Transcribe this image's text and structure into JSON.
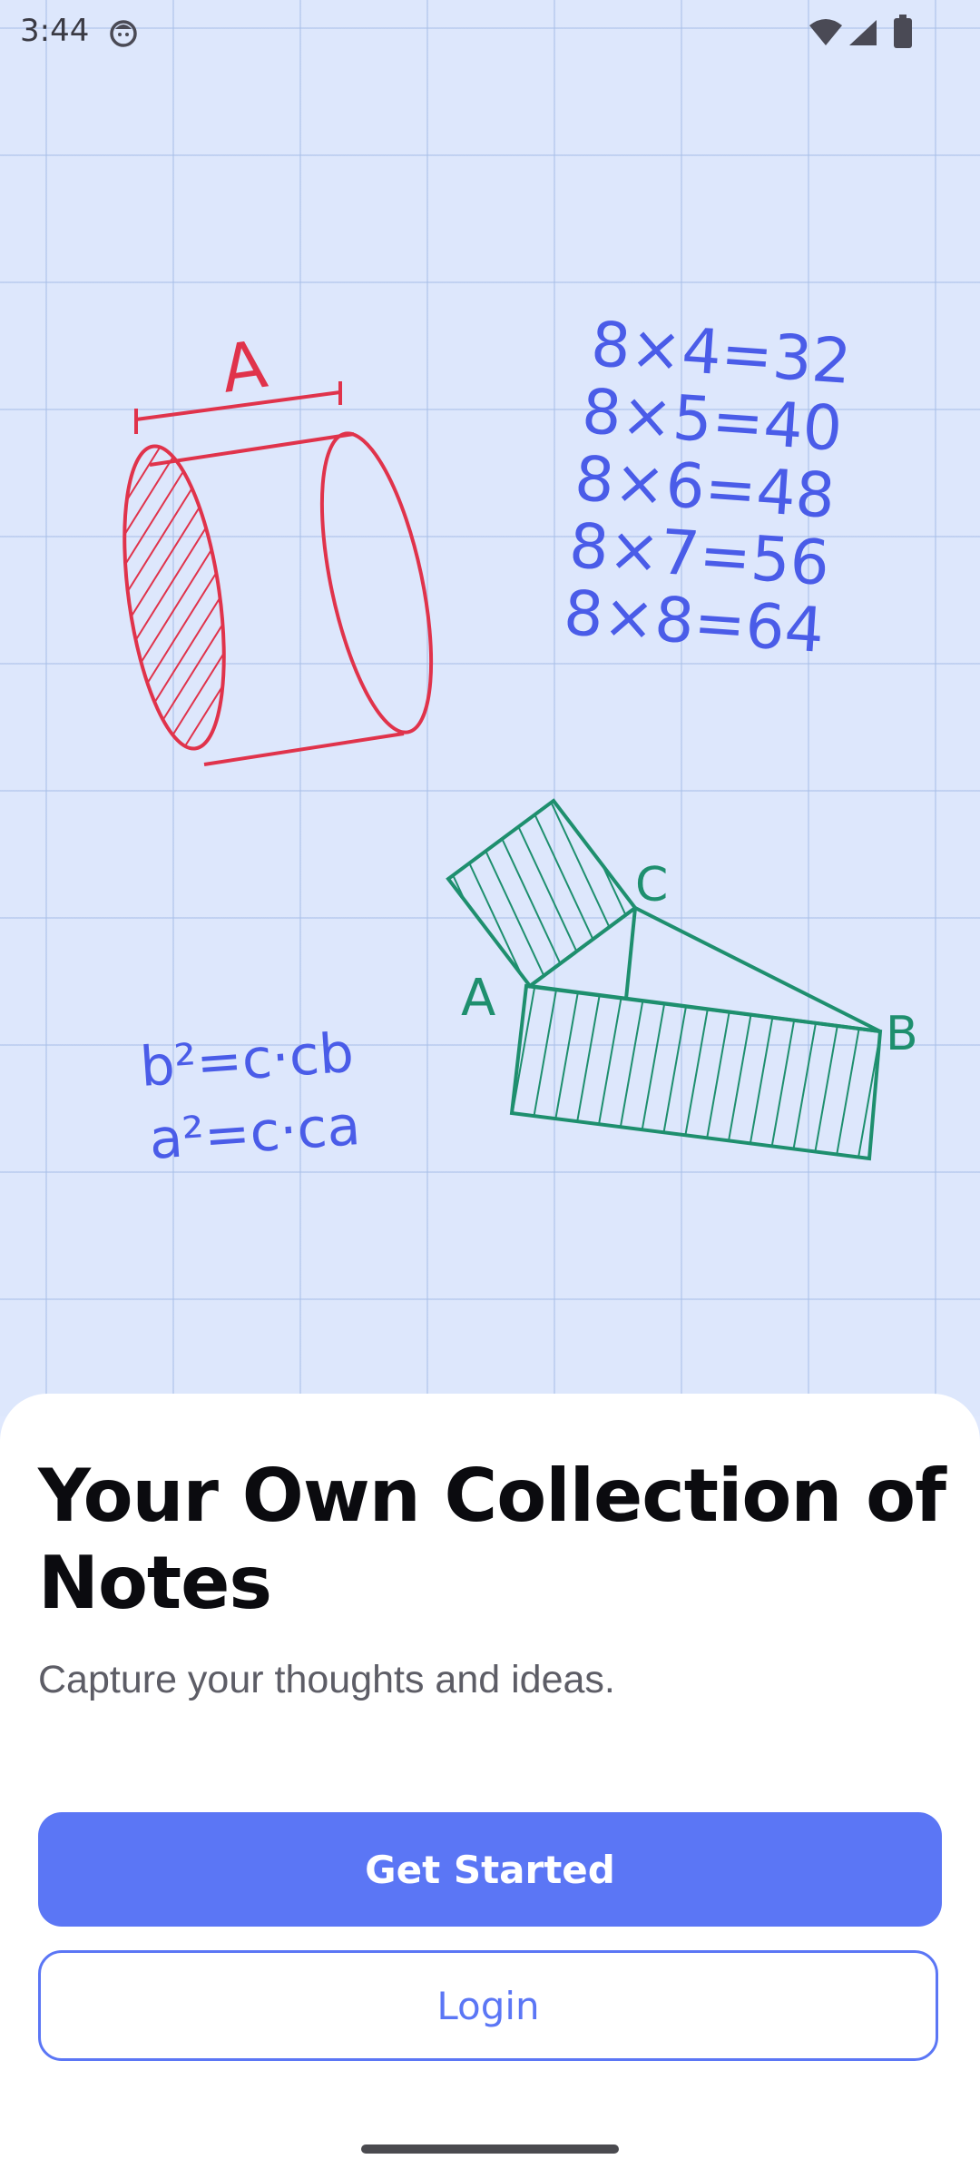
{
  "status_bar": {
    "time": "3:44",
    "icons": [
      "app-notification-icon",
      "wifi-icon",
      "signal-icon",
      "battery-icon"
    ]
  },
  "illustration": {
    "cylinder_label": "A",
    "multiplication": [
      "8×4=32",
      "8×5=40",
      "8×6=48",
      "8×7=56",
      "8×8=64"
    ],
    "formula_b": "b²=c·cb",
    "formula_a": "a²=c·ca",
    "triangle_labels": {
      "a": "A",
      "b": "B",
      "c": "C"
    },
    "colors": {
      "red": "#e0334b",
      "blue": "#4a5ce8",
      "green": "#1e8f6e",
      "background": "#dde7fc"
    }
  },
  "onboarding": {
    "title": "Your Own Collection of Notes",
    "subtitle": "Capture your thoughts and ideas.",
    "primary_button": "Get Started",
    "secondary_button": "Login"
  },
  "theme": {
    "accent": "#5b76f5",
    "text": "#0b0b0f",
    "muted": "#5d5d66"
  }
}
